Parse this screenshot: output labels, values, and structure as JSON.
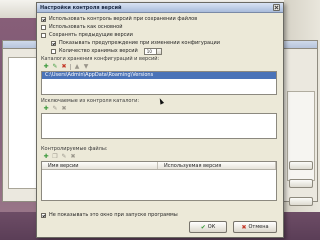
{
  "dialog": {
    "title": "Настройки контроля версий"
  },
  "options": [
    {
      "label": "Использовать контроль версий при сохранении файлов",
      "checked": true
    },
    {
      "label": "Использовать как основной",
      "checked": false
    },
    {
      "label": "Сохранять предыдущие версии",
      "checked": false
    },
    {
      "label": "Показывать предупреждение при изменении конфигурации",
      "checked": true
    },
    {
      "label": "Количество хранимых версий",
      "checked": false,
      "spin_value": "10"
    }
  ],
  "sections": {
    "configs": {
      "label": "Каталоги хранения конфигураций и версий:",
      "items": [
        {
          "text": "C:\\Users\\Admin\\AppData\\Roaming\\Versions",
          "selected": true
        },
        {
          "text": "",
          "selected": false
        },
        {
          "text": "",
          "selected": false
        }
      ]
    },
    "excluded": {
      "label": "Исключаемые из контроля каталоги:"
    },
    "extensions": {
      "label": "Контролируемые файлы:",
      "columns": [
        "Имя версии",
        "Используемая версия"
      ]
    }
  },
  "footer": {
    "checkbox_label": "Не показывать это окно при запуске программы",
    "checked": true
  },
  "buttons": {
    "ok": "ОК",
    "cancel": "Отмена"
  },
  "colors": {
    "selection": "#4a73b8",
    "dialog_bg": "#ece9d8",
    "desktop": "#7d5a76"
  }
}
